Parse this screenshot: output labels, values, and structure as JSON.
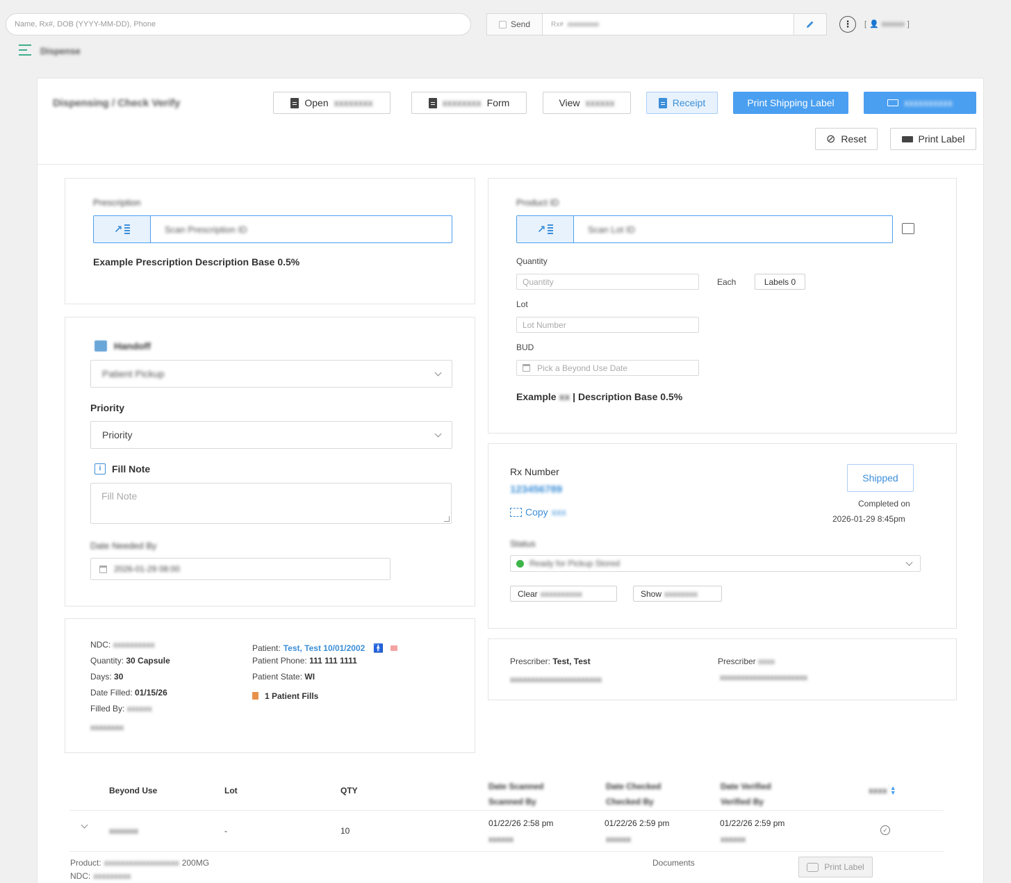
{
  "topbar": {
    "search_placeholder": "Name, Rx#, DOB (YYYY-MM-DD), Phone",
    "send_label": "Send",
    "rx_prefix": "Rx#",
    "rx_hidden": "xxxxxxxxx",
    "user_prefix": "[",
    "user_hidden": "xxxxxx",
    "user_suffix": "]"
  },
  "breadcrumb": {
    "label": "Dispense"
  },
  "header": {
    "title": "Dispensing / Check Verify",
    "buttons": {
      "open_label": "Open",
      "open_hidden": "xxxxxxxx",
      "form_hidden": "xxxxxxxx",
      "form_label": "Form",
      "view_label": "View",
      "view_hidden": "xxxxxx",
      "receipt_label": "Receipt",
      "print_shipping_label": "Print Shipping Label",
      "extra_primary_hidden": "xxxxxxxxxx",
      "reset_label": "Reset",
      "print_label": "Print Label"
    }
  },
  "prescription_panel": {
    "label": "Prescription",
    "scan_placeholder": "Scan Prescription ID",
    "description": "Example Prescription Description Base 0.5%"
  },
  "product_panel": {
    "label": "Product ID",
    "scan_placeholder": "Scan Lot ID",
    "quantity_label": "Quantity",
    "quantity_placeholder": "Quantity",
    "unit": "Each",
    "labels_button": "Labels 0",
    "lot_label": "Lot",
    "lot_placeholder": "Lot Number",
    "bud_label": "BUD",
    "bud_placeholder": "Pick a Beyond Use Date",
    "description_prefix": "Example",
    "description_hidden": "xx",
    "description_suffix": "| Description Base 0.5%"
  },
  "fill_panel": {
    "handoff_label": "Handoff",
    "handoff_value": "Patient Pickup",
    "priority_label": "Priority",
    "priority_placeholder": "Priority",
    "fill_note_label": "Fill Note",
    "fill_note_placeholder": "Fill Note",
    "date_label": "Date Needed By",
    "date_value": "2026-01-29 08:00"
  },
  "rx_panel": {
    "rx_number_label": "Rx Number",
    "rx_number_value": "123456789",
    "copy_label": "Copy",
    "copy_hidden": "xxx",
    "status_button": "Shipped",
    "completed_on_label": "Completed on",
    "completed_on_value": "2026-01-29 8:45pm",
    "status_label": "Status",
    "status_value": "Ready for Pickup Stored",
    "clear_label": "Clear",
    "clear_hidden": "xxxxxxxxxx",
    "show_label": "Show",
    "show_hidden": "xxxxxxxx"
  },
  "info_panel": {
    "ndc_label": "NDC:",
    "ndc_value": "xxxxxxxxxx",
    "quantity_label": "Quantity:",
    "quantity_value": "30 Capsule",
    "days_label": "Days:",
    "days_value": "30",
    "date_filled_label": "Date Filled:",
    "date_filled_value": "01/15/26",
    "filled_by_label": "Filled By:",
    "filled_by_value": "xxxxxx",
    "extra_hidden": "xxxxxxxx",
    "patient_label": "Patient:",
    "patient_value": "Test, Test 10/01/2002",
    "patient_phone_label": "Patient Phone:",
    "patient_phone_value": "111 111 1111",
    "patient_state_label": "Patient State:",
    "patient_state_value": "WI",
    "patient_fills": "1 Patient Fills"
  },
  "prescriber_panel": {
    "prescriber_label": "Prescriber:",
    "prescriber_value": "Test, Test",
    "prescriber_sub_hidden": "xxxxxxxxxxxxxxxxxxxxxx",
    "prescriber2_label": "Prescriber",
    "prescriber2_hidden": "xxxx",
    "prescriber2_sub_hidden": "xxxxxxxxxxxxxxxxxxxxx"
  },
  "table": {
    "headers": {
      "beyond_use": "Beyond Use",
      "lot": "Lot",
      "qty": "QTY",
      "col4_line1": "Date Scanned",
      "col4_line2": "Scanned By",
      "col5_line1": "Date Checked",
      "col5_line2": "Checked By",
      "col6_line1": "Date Verified",
      "col6_line2": "Verified By",
      "col7": "xxxx"
    },
    "row": {
      "beyond_use": "xxxxxxx",
      "lot": "-",
      "qty": "10",
      "col4_date": "01/22/26 2:58 pm",
      "col4_user": "xxxxxx",
      "col5_date": "01/22/26 2:59 pm",
      "col5_user": "xxxxxx",
      "col6_date": "01/22/26 2:59 pm",
      "col6_user": "xxxxxx"
    },
    "expanded": {
      "product_label": "Product:",
      "product_hidden": "xxxxxxxxxxxxxxxxxx",
      "product_suffix": "200MG",
      "ndc_label": "NDC:",
      "ndc_hidden": "xxxxxxxxx",
      "documents_label": "Documents",
      "print_label": "Print Label"
    }
  },
  "colors": {
    "accent": "#4a9ff0",
    "brand_green": "#3fae8b",
    "status_green": "#3db54a"
  }
}
